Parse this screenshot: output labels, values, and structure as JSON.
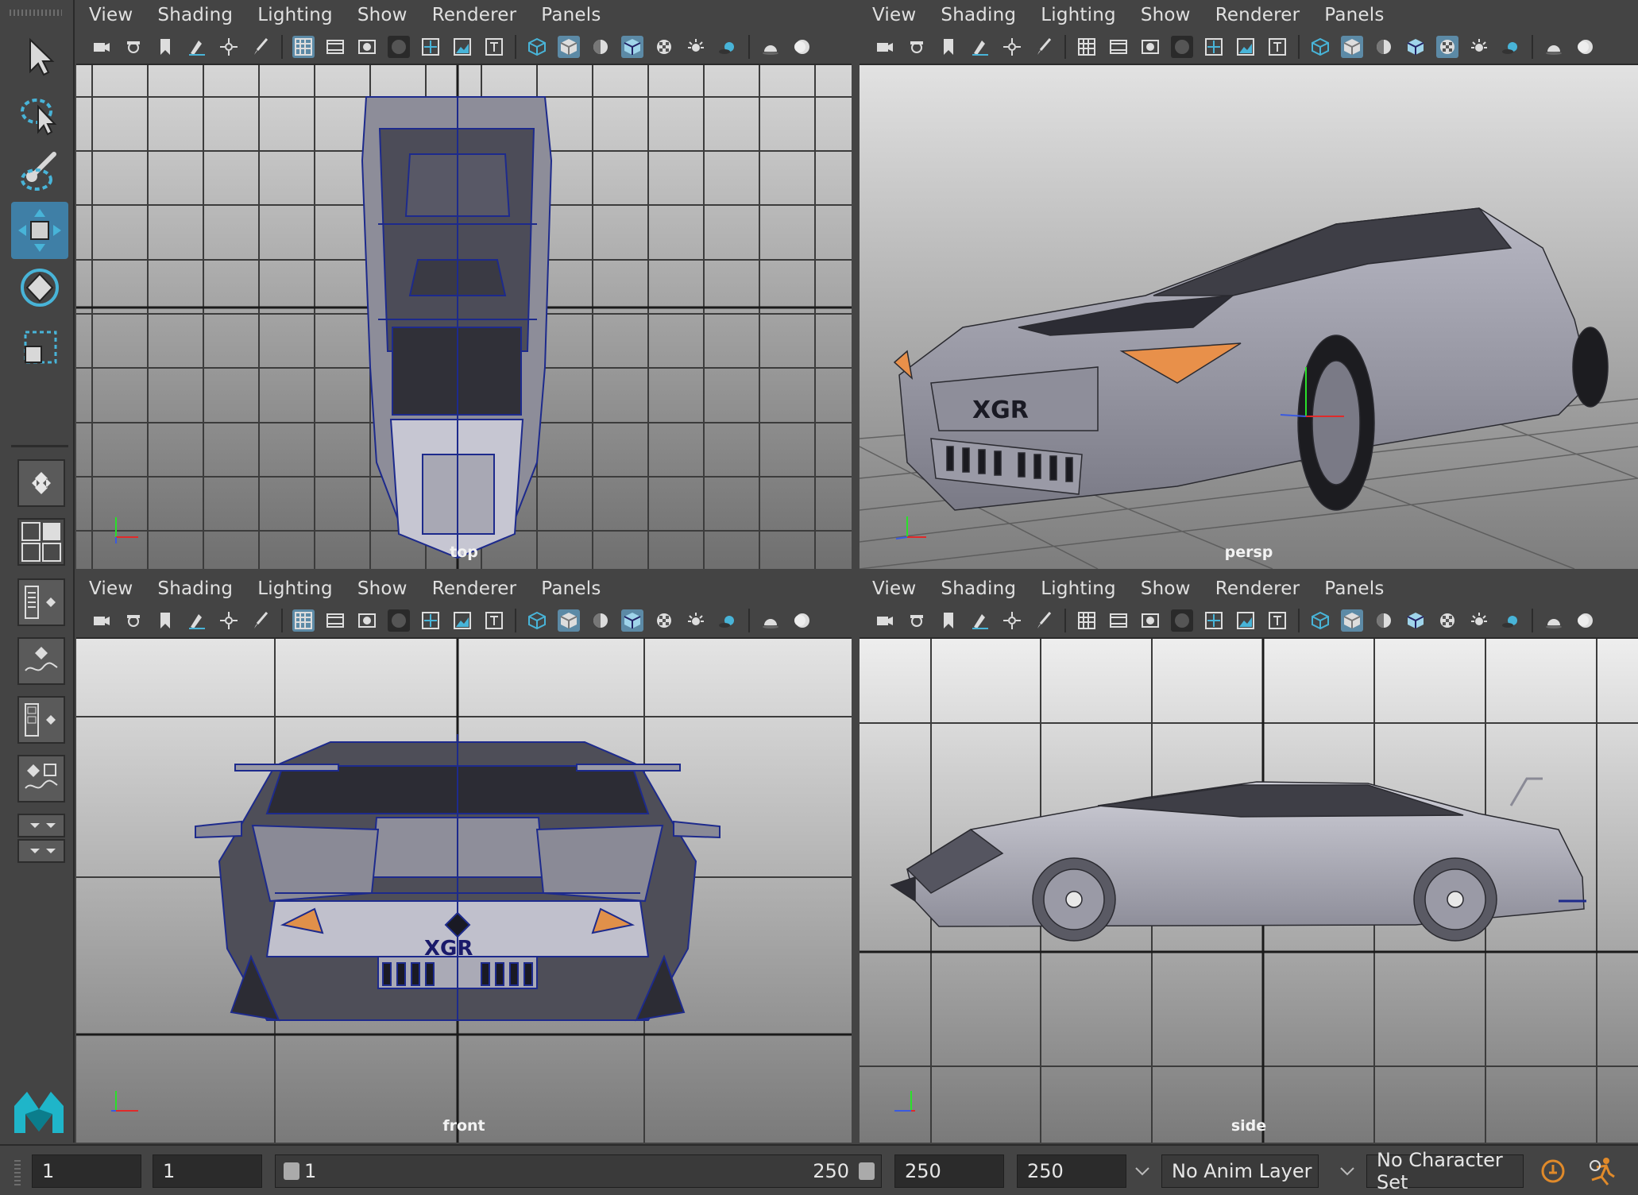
{
  "menus": [
    "View",
    "Shading",
    "Lighting",
    "Show",
    "Renderer",
    "Panels"
  ],
  "viewports": [
    {
      "camera": "top",
      "axes": {
        "a": "y",
        "b": "x",
        "c": "z"
      }
    },
    {
      "camera": "persp",
      "axes": {
        "a": "y",
        "b": "x",
        "c": "z"
      }
    },
    {
      "camera": "front",
      "axes": {
        "a": "y",
        "b": "x",
        "c": "z"
      }
    },
    {
      "camera": "side",
      "axes": {
        "a": "y",
        "b": "z",
        "c": "z"
      }
    }
  ],
  "model_badge": "XGR",
  "timeline": {
    "start_time": "1",
    "playback_start": "1",
    "range_start": "1",
    "range_end": "250",
    "playback_end": "250",
    "end_time": "250",
    "anim_layer": "No Anim Layer",
    "character_set": "No Character Set"
  },
  "colors": {
    "accent": "#5c8aa6",
    "active_tool": "#3f7fa6",
    "wire": "#1d2a8c",
    "body": "#a8a8b4"
  }
}
